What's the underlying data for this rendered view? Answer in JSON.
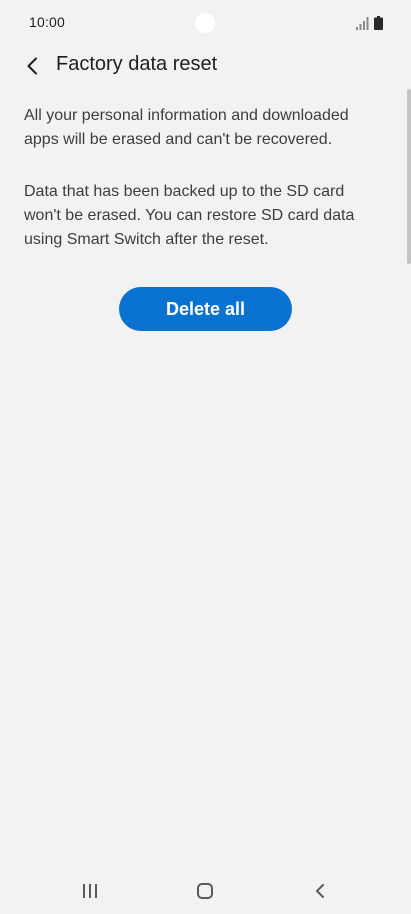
{
  "status_bar": {
    "time": "10:00",
    "icons": [
      "signal-icon",
      "battery-icon"
    ]
  },
  "header": {
    "back_icon": "chevron-left-icon",
    "title": "Factory data reset"
  },
  "content": {
    "paragraph_1": "All your personal information and downloaded apps will be erased and can't be recovered.",
    "paragraph_2": "Data that has been backed up to the SD card won't be erased. You can restore SD card data using Smart Switch after the reset."
  },
  "actions": {
    "delete_all_label": "Delete all"
  },
  "navigation": {
    "icons": [
      "recents-icon",
      "home-icon",
      "back-icon"
    ]
  },
  "colors": {
    "background": "#f2f2f2",
    "accent": "#0a73d2",
    "text_primary": "#1f1f1f",
    "text_secondary": "#3d3d3d"
  }
}
